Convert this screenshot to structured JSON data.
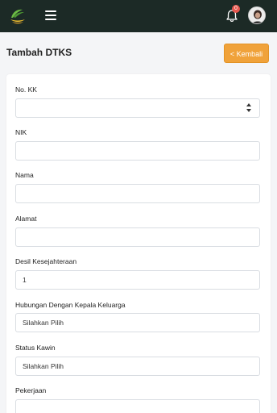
{
  "header": {
    "notification_count": "0",
    "icons": [
      "app-logo",
      "hamburger-menu-icon",
      "bell-icon",
      "user-avatar"
    ]
  },
  "page": {
    "title": "Tambah DTKS",
    "back_label": "< Kembali"
  },
  "form": {
    "no_kk": {
      "label": "No. KK",
      "value": ""
    },
    "nik": {
      "label": "NIK",
      "value": ""
    },
    "nama": {
      "label": "Nama",
      "value": ""
    },
    "alamat": {
      "label": "Alamat",
      "value": ""
    },
    "desil": {
      "label": "Desil Kesejahteraan",
      "value": "1"
    },
    "hubungan": {
      "label": "Hubungan Dengan Kepala Keluarga",
      "value": "Silahkan Pilih"
    },
    "status_kawin": {
      "label": "Status Kawin",
      "value": "Silahkan Pilih"
    },
    "pekerjaan": {
      "label": "Pekerjaan",
      "value": ""
    }
  },
  "colors": {
    "topbar": "#1c2a26",
    "accent": "#f0a23a",
    "badge": "#e8584f"
  }
}
